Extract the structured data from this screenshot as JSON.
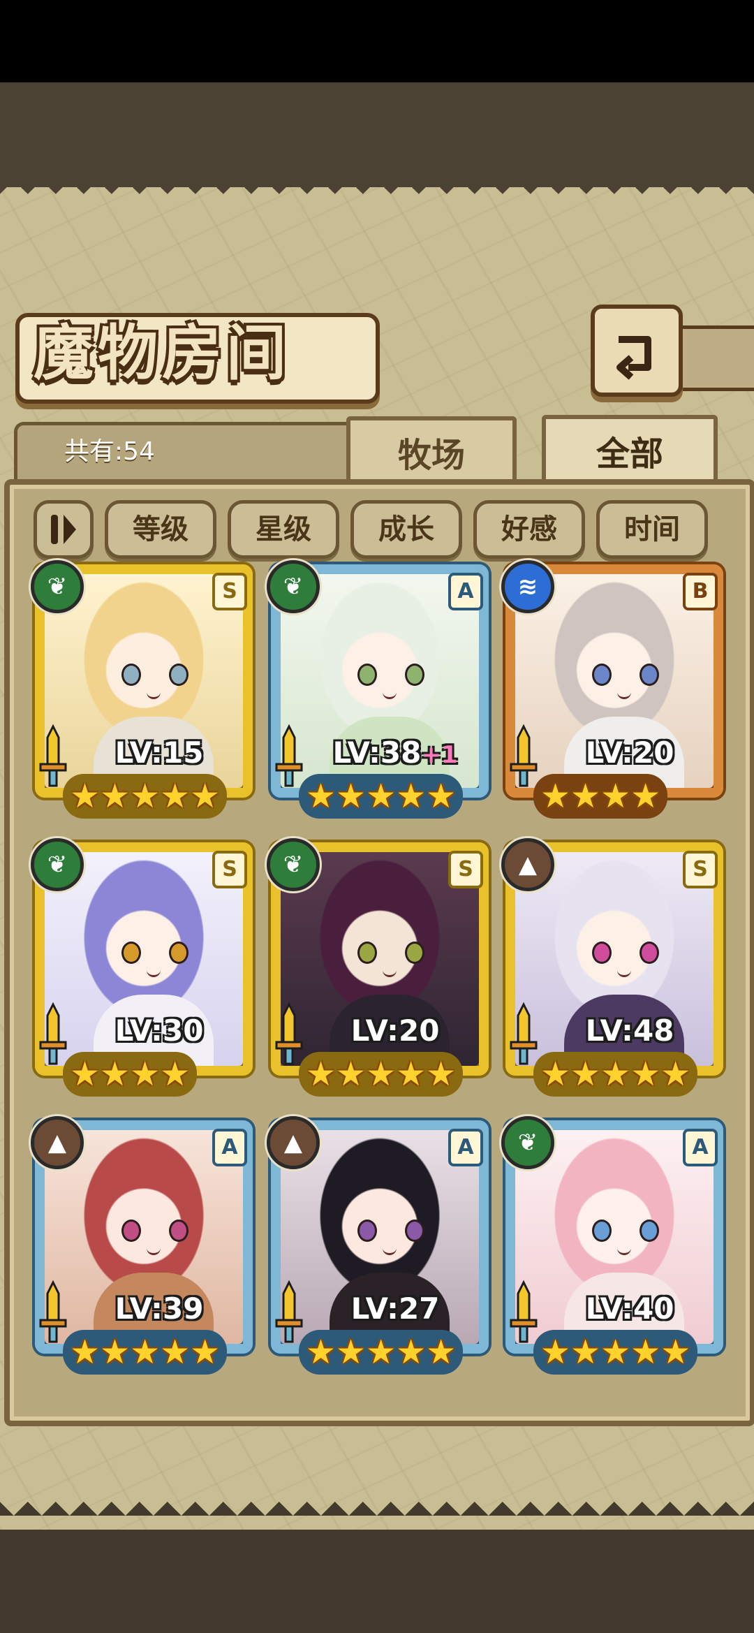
{
  "screen": {
    "title": "魔物房间",
    "back_icon": "back-arrow-icon",
    "count_label": "共有:54"
  },
  "tabs": [
    {
      "label": "牧场",
      "active": false
    },
    {
      "label": "全部",
      "active": true
    }
  ],
  "sort": {
    "toggle_icon": "sort-toggle-icon",
    "buttons": [
      "等级",
      "星级",
      "成长",
      "好感",
      "时间"
    ]
  },
  "monsters": [
    {
      "level": "LV:15",
      "plus": "",
      "rank": "S",
      "element": "leaf",
      "stars": 5,
      "frame": "gold"
    },
    {
      "level": "LV:38",
      "plus": "+1",
      "rank": "A",
      "element": "leaf",
      "stars": 5,
      "frame": "blue"
    },
    {
      "level": "LV:20",
      "plus": "",
      "rank": "B",
      "element": "water",
      "stars": 4,
      "frame": "bronze"
    },
    {
      "level": "LV:30",
      "plus": "",
      "rank": "S",
      "element": "leaf",
      "stars": 4,
      "frame": "gold"
    },
    {
      "level": "LV:20",
      "plus": "",
      "rank": "S",
      "element": "leaf",
      "stars": 5,
      "frame": "gold"
    },
    {
      "level": "LV:48",
      "plus": "",
      "rank": "S",
      "element": "earth",
      "stars": 5,
      "frame": "gold"
    },
    {
      "level": "LV:39",
      "plus": "",
      "rank": "A",
      "element": "earth",
      "stars": 5,
      "frame": "blue"
    },
    {
      "level": "LV:27",
      "plus": "",
      "rank": "A",
      "element": "earth",
      "stars": 5,
      "frame": "blue"
    },
    {
      "level": "LV:40",
      "plus": "",
      "rank": "A",
      "element": "leaf",
      "stars": 5,
      "frame": "blue"
    }
  ],
  "colors": {
    "gold_frame": "#e9c12a",
    "blue_frame": "#7fb8d6",
    "bronze_frame": "#d88a3a",
    "leaf_element": "#2f7d3a",
    "water_element": "#2d6ed6",
    "earth_element": "#6b4a36"
  }
}
